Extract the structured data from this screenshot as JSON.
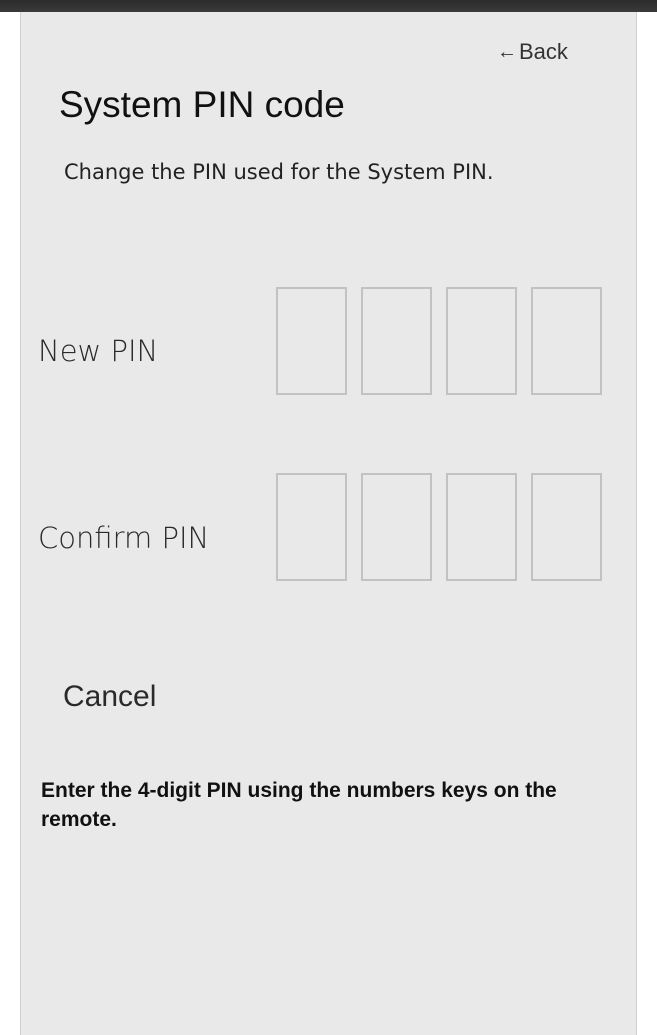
{
  "header": {
    "back_label": "Back",
    "title": "System PIN code",
    "subtitle": "Change the PIN used for the System PIN."
  },
  "new_pin": {
    "label": "New PIN",
    "digits": [
      "",
      "",
      "",
      ""
    ]
  },
  "confirm_pin": {
    "label": "Confirm PIN",
    "digits": [
      "",
      "",
      "",
      ""
    ]
  },
  "actions": {
    "cancel_label": "Cancel"
  },
  "hint": "Enter the 4-digit PIN using the numbers keys on the remote.",
  "colors": {
    "panel_background": "#e9e9e9",
    "pin_border": "#c2c2c2",
    "top_bar": "#2b2b2b"
  }
}
